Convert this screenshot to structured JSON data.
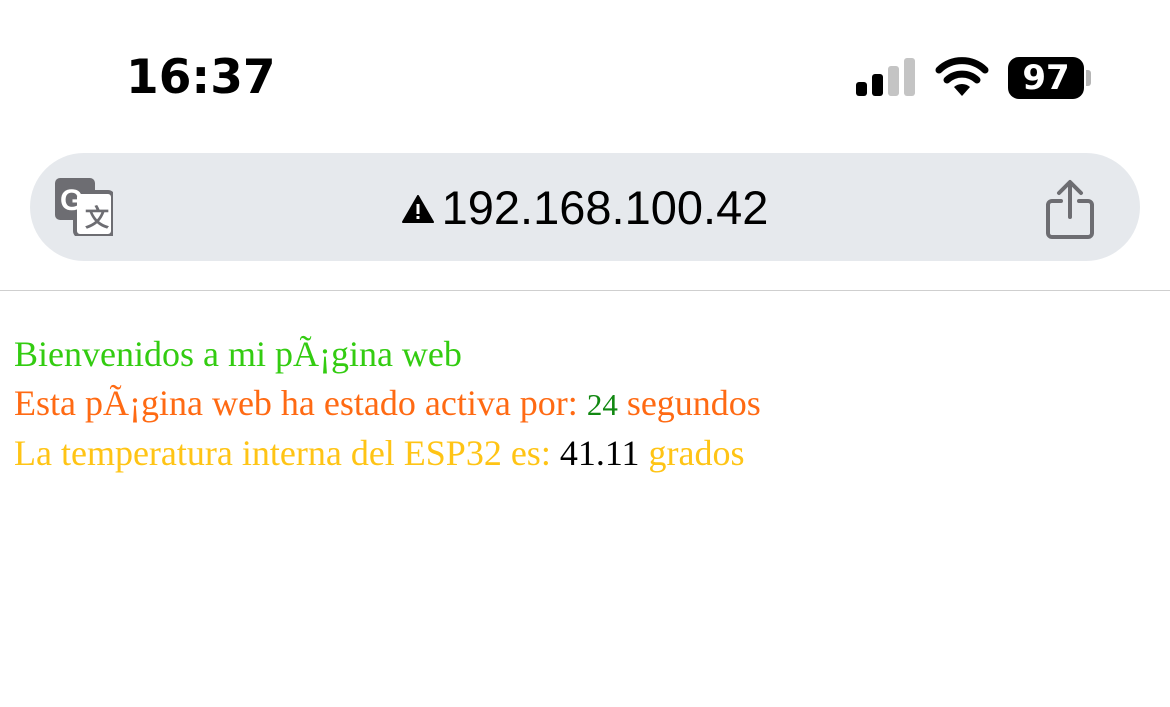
{
  "status_bar": {
    "time": "16:37",
    "battery_level": "97",
    "signal_icon": "signal-strength-icon",
    "wifi_icon": "wifi-icon"
  },
  "address_bar": {
    "url": "192.168.100.42",
    "translate_icon": "translate-icon",
    "warning_icon": "warning-icon",
    "share_icon": "share-icon"
  },
  "page": {
    "welcome": "Bienvenidos a mi pÃ¡gina web",
    "uptime_prefix": "Esta pÃ¡gina web ha estado activa por: ",
    "uptime_value": "24",
    "uptime_suffix": " segundos",
    "temp_prefix": "La temperatura interna del ESP32 es: ",
    "temp_value": "41.11",
    "temp_suffix": " grados"
  },
  "colors": {
    "welcome": "#33cc11",
    "uptime": "#ff6a13",
    "counter": "#118811",
    "temperature": "#ffc415"
  }
}
